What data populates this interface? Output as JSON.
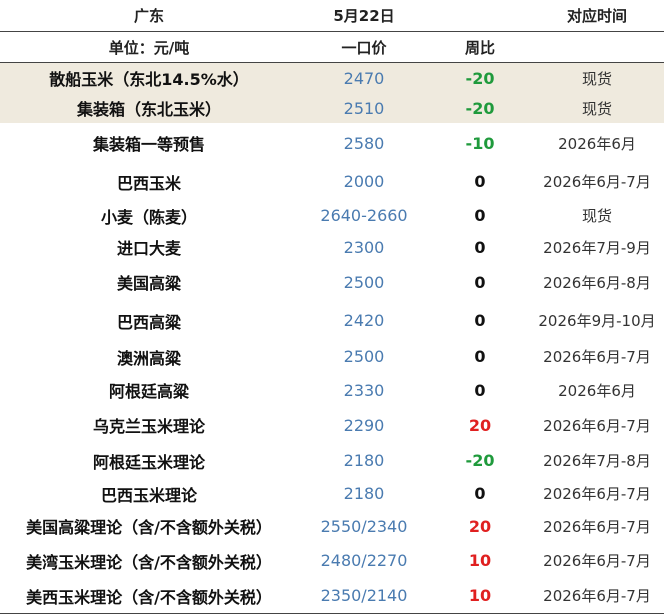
{
  "header": {
    "region": "广东",
    "date": "5月22日",
    "period": "对应时间",
    "unit": "单位：元/吨",
    "price": "一口价",
    "change": "周比"
  },
  "colors": {
    "highlight_row_bg": "#efeade",
    "price_text": "#4a7bb0",
    "change_up": "#e02020",
    "change_down": "#1f9a3c",
    "change_flat": "#111111"
  },
  "rows": [
    {
      "name": "散船玉米（东北14.5%水）",
      "price": "2470",
      "change": "-20",
      "period": "现货",
      "highlight": true
    },
    {
      "name": "集装箱（东北玉米）",
      "price": "2510",
      "change": "-20",
      "period": "现货",
      "highlight": true
    },
    {
      "name": "集装箱一等预售",
      "price": "2580",
      "change": "-10",
      "period": "2026年6月",
      "highlight": false
    },
    {
      "name": "巴西玉米",
      "price": "2000",
      "change": "0",
      "period": "2026年6月-7月",
      "highlight": false
    },
    {
      "name": "小麦（陈麦）",
      "price": "2640-2660",
      "change": "0",
      "period": "现货",
      "highlight": false
    },
    {
      "name": "进口大麦",
      "price": "2300",
      "change": "0",
      "period": "2026年7月-9月",
      "highlight": false
    },
    {
      "name": "美国高粱",
      "price": "2500",
      "change": "0",
      "period": "2026年6月-8月",
      "highlight": false
    },
    {
      "name": "巴西高粱",
      "price": "2420",
      "change": "0",
      "period": "2026年9月-10月",
      "highlight": false
    },
    {
      "name": "澳洲高粱",
      "price": "2500",
      "change": "0",
      "period": "2026年6月-7月",
      "highlight": false
    },
    {
      "name": "阿根廷高粱",
      "price": "2330",
      "change": "0",
      "period": "2026年6月",
      "highlight": false
    },
    {
      "name": "乌克兰玉米理论",
      "price": "2290",
      "change": "20",
      "period": "2026年6月-7月",
      "highlight": false
    },
    {
      "name": "阿根廷玉米理论",
      "price": "2180",
      "change": "-20",
      "period": "2026年7月-8月",
      "highlight": false
    },
    {
      "name": "巴西玉米理论",
      "price": "2180",
      "change": "0",
      "period": "2026年6月-7月",
      "highlight": false
    },
    {
      "name": "美国高粱理论（含/不含额外关税）",
      "price": "2550/2340",
      "change": "20",
      "period": "2026年6月-7月",
      "highlight": false
    },
    {
      "name": "美湾玉米理论（含/不含额外关税）",
      "price": "2480/2270",
      "change": "10",
      "period": "2026年6月-7月",
      "highlight": false
    },
    {
      "name": "美西玉米理论（含/不含额外关税）",
      "price": "2350/2140",
      "change": "10",
      "period": "2026年6月-7月",
      "highlight": false
    }
  ]
}
